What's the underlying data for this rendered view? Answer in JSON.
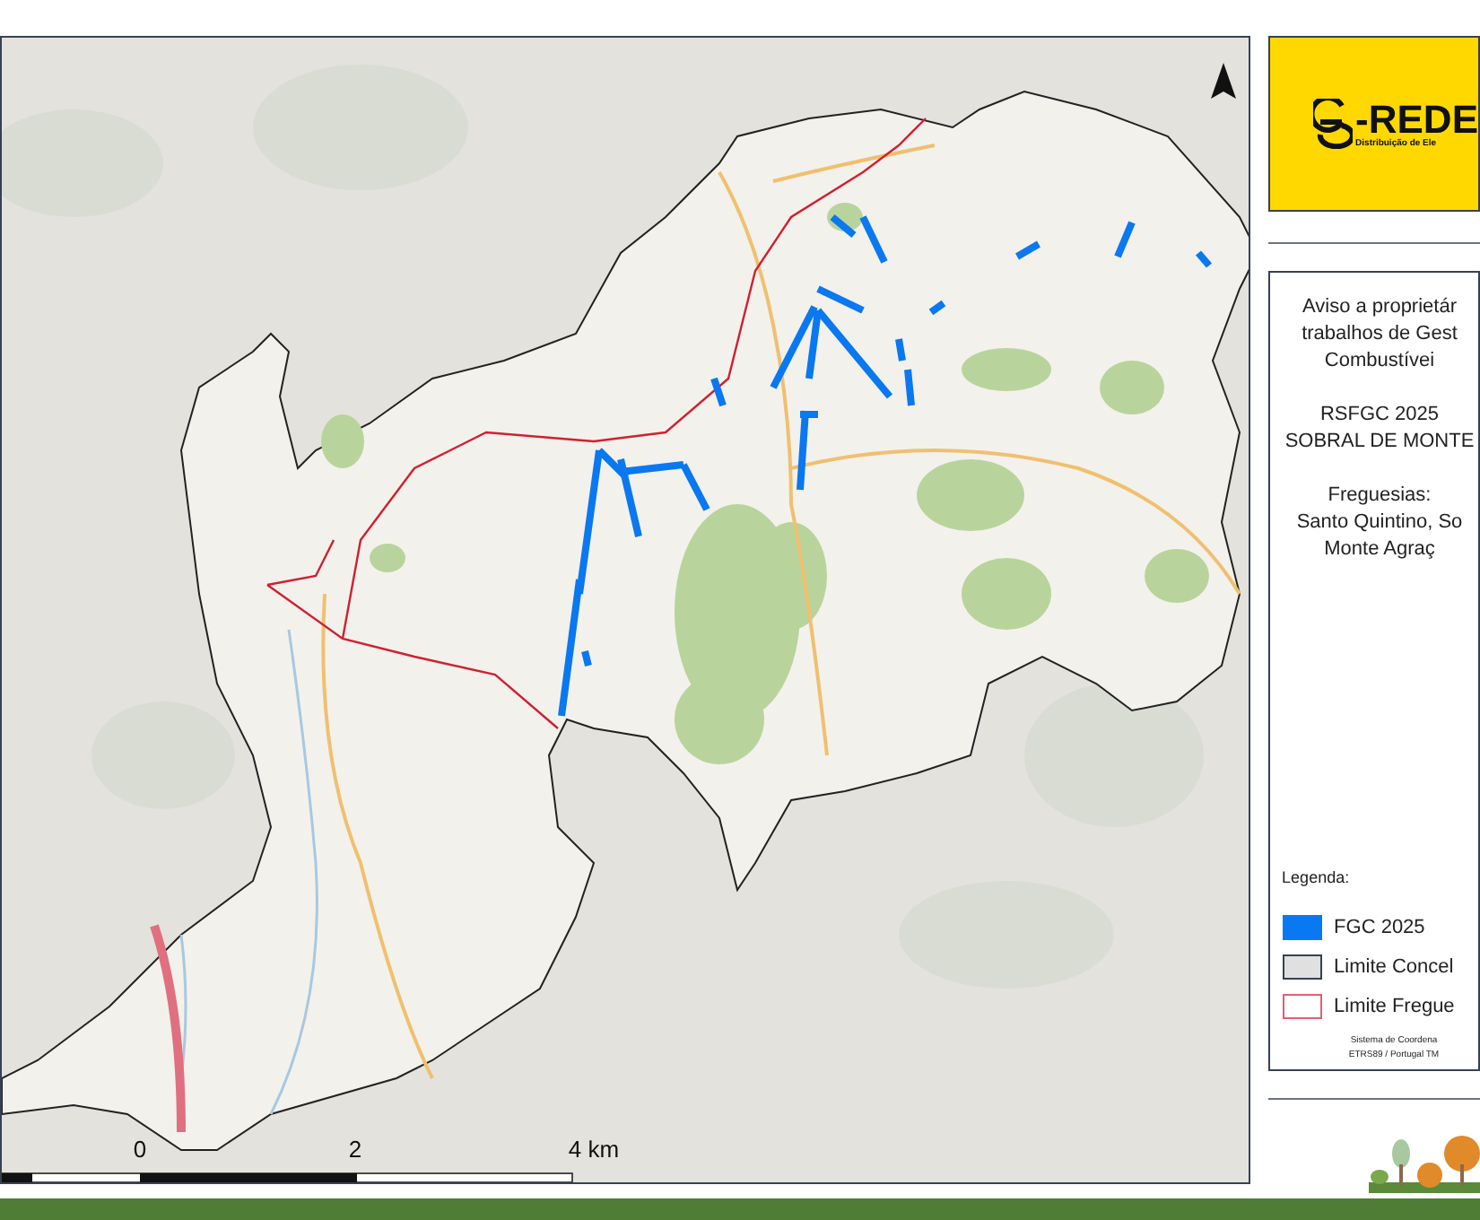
{
  "logo": {
    "wordmark": "-REDE",
    "tagline": "Distribuição de Ele"
  },
  "notice": {
    "lines": [
      "Aviso a proprietár",
      "trabalhos de Gest",
      "Combustívei"
    ],
    "plan": [
      "RSFGC 2025",
      "SOBRAL DE MONTE"
    ],
    "parishes_label": "Freguesias:",
    "parishes": [
      "Santo Quintino, So",
      "Monte Agraç"
    ]
  },
  "legend": {
    "title": "Legenda:",
    "items": [
      {
        "label": "FGC 2025",
        "kind": "fill",
        "color": "#0a78f0"
      },
      {
        "label": "Limite Concel",
        "kind": "fill",
        "color": "#e0e0e0"
      },
      {
        "label": "Limite Fregue",
        "kind": "outline",
        "color": "#e06070"
      }
    ],
    "crs": [
      "Sistema de Coordena",
      "ETRS89 / Portugal TM"
    ]
  },
  "scale_bar": {
    "labels": [
      "0",
      "2",
      "4 km"
    ]
  }
}
